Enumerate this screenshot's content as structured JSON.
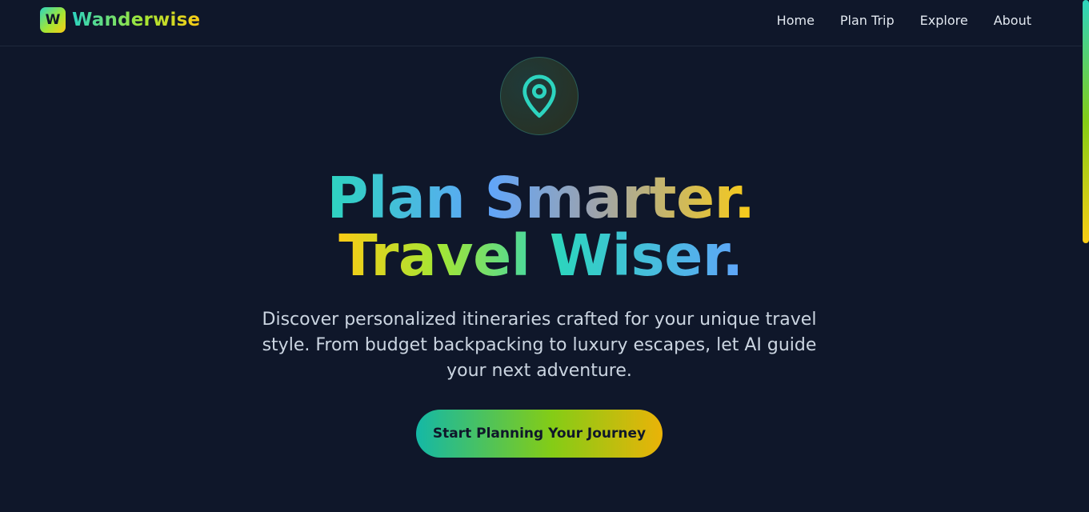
{
  "brand": {
    "logo_letter": "W",
    "name": "Wanderwise"
  },
  "nav": {
    "links": [
      "Home",
      "Plan Trip",
      "Explore",
      "About"
    ]
  },
  "hero": {
    "icon": "map-pin-icon",
    "headline_line1": "Plan Smarter.",
    "headline_line2": "Travel Wiser.",
    "subtext": "Discover personalized itineraries crafted for your unique travel style. From budget backpacking to luxury escapes, let AI guide your next adventure.",
    "cta_label": "Start Planning Your Journey"
  },
  "colors": {
    "background": "#0f172a",
    "accent_teal": "#2dd4bf",
    "accent_lime": "#a3e635",
    "accent_yellow": "#facc15",
    "accent_blue": "#60a5fa"
  }
}
